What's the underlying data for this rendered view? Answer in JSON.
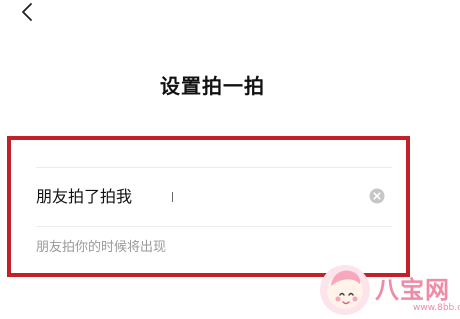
{
  "header": {
    "back_icon": "chevron-left-icon",
    "title": "设置拍一拍"
  },
  "pat_settings": {
    "input_value": "朋友拍了拍我",
    "clear_icon": "clear-circle-icon",
    "hint": "朋友拍你的时候将出现"
  },
  "highlight": {
    "frame_color": "#c4202a"
  },
  "watermark": {
    "name": "八宝网",
    "url": "www.8bb.com"
  }
}
